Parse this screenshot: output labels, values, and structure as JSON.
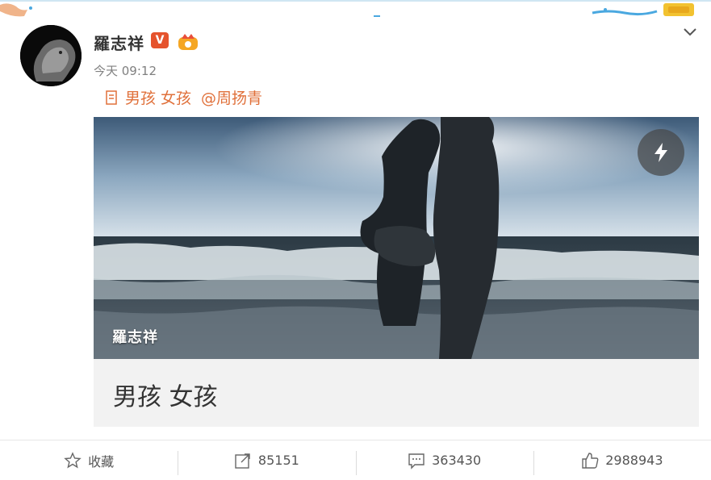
{
  "post": {
    "author": "羅志祥",
    "time": "今天 09:12",
    "text": "男孩 女孩",
    "mention": "@周扬青"
  },
  "card": {
    "author_overlay": "羅志祥",
    "title": "男孩 女孩"
  },
  "actions": {
    "favorite_label": "收藏",
    "repost_count": "85151",
    "comment_count": "363430",
    "like_count": "2988943"
  },
  "colors": {
    "accent": "#e0703a",
    "v_badge": "#e5532d"
  },
  "icons": [
    "caret-down-icon",
    "verified-v-icon",
    "crown-icon",
    "document-icon",
    "flash-icon",
    "star-icon",
    "repost-icon",
    "comment-icon",
    "like-icon"
  ]
}
